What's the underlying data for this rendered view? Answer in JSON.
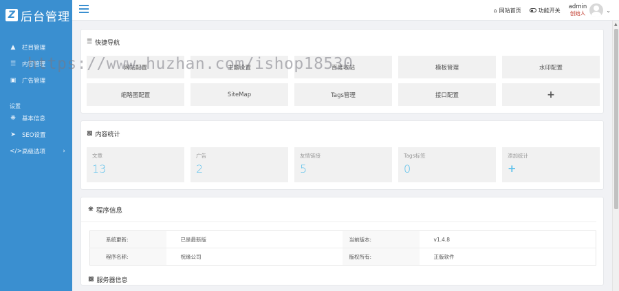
{
  "app": {
    "logo_mark": "Z",
    "logo_text": "后台管理"
  },
  "sidebar": {
    "items": [
      {
        "label": "栏目管理",
        "icon": "sitemap-icon"
      },
      {
        "label": "内容管理",
        "icon": "list-icon"
      },
      {
        "label": "广告管理",
        "icon": "image-icon"
      }
    ],
    "section_label": "设置",
    "settings_items": [
      {
        "label": "基本信息",
        "icon": "gear-icon"
      },
      {
        "label": "SEO设置",
        "icon": "send-icon"
      },
      {
        "label": "高级选项",
        "icon": "code-icon"
      }
    ]
  },
  "topbar": {
    "home_label": "网站首页",
    "features_label": "功能开关",
    "user_name": "admin",
    "user_role": "创始人"
  },
  "quick_nav": {
    "title": "快捷导航",
    "items": [
      "网站配置",
      "主题设置",
      "百度收站",
      "模板管理",
      "水印配置",
      "缩略图配置",
      "SiteMap",
      "Tags管理",
      "接口配置",
      "+"
    ]
  },
  "stats": {
    "title": "内容统计",
    "items": [
      {
        "label": "文章",
        "value": "13"
      },
      {
        "label": "广告",
        "value": "2"
      },
      {
        "label": "友情链接",
        "value": "5"
      },
      {
        "label": "Tags标签",
        "value": "0"
      },
      {
        "label": "添加统计",
        "value": "+"
      }
    ]
  },
  "program_info": {
    "title": "程序信息",
    "rows": [
      {
        "k1": "系统更新:",
        "v1": "已是最新版",
        "k2": "当前版本:",
        "v2": "v1.4.8"
      },
      {
        "k1": "程序名称:",
        "v1": "祝缘公司",
        "k2": "版权所有:",
        "v2": "正版软件"
      }
    ]
  },
  "next_panel": {
    "title": "服务器信息"
  },
  "watermark": {
    "text": "https://www.huzhan.com/ishop18530"
  },
  "colors": {
    "sidebar": "#3a8fd0",
    "accent": "#5bc0eb",
    "role": "#c0392b"
  }
}
